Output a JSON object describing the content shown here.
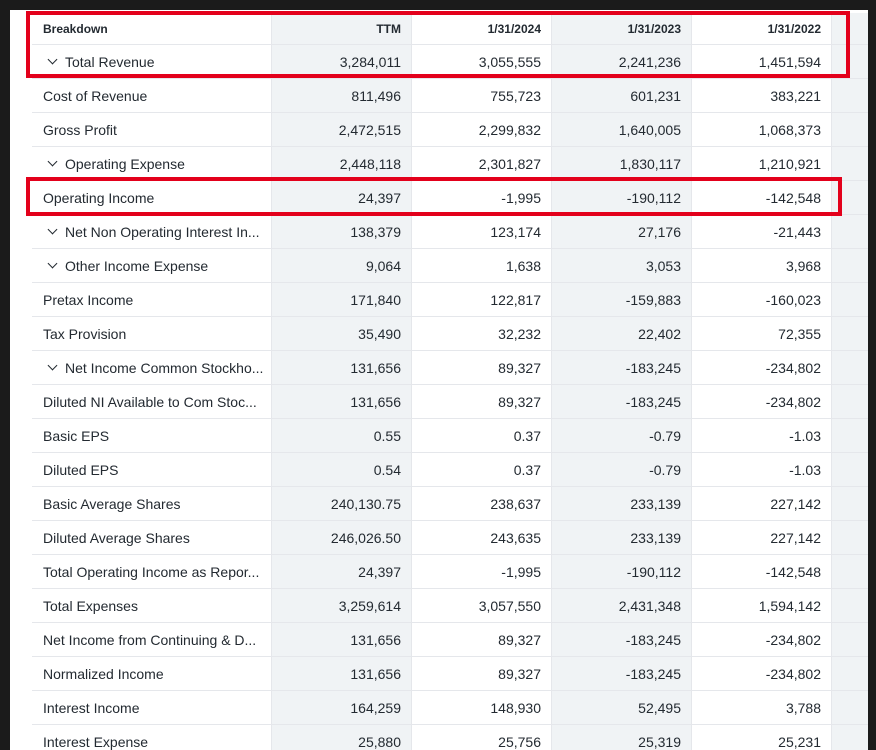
{
  "table": {
    "columns": [
      "Breakdown",
      "TTM",
      "1/31/2024",
      "1/31/2023",
      "1/31/2022"
    ],
    "rows": [
      {
        "label": "Total Revenue",
        "expandable": true,
        "values": [
          "3,284,011",
          "3,055,555",
          "2,241,236",
          "1,451,594"
        ]
      },
      {
        "label": "Cost of Revenue",
        "expandable": false,
        "values": [
          "811,496",
          "755,723",
          "601,231",
          "383,221"
        ]
      },
      {
        "label": "Gross Profit",
        "expandable": false,
        "values": [
          "2,472,515",
          "2,299,832",
          "1,640,005",
          "1,068,373"
        ]
      },
      {
        "label": "Operating Expense",
        "expandable": true,
        "values": [
          "2,448,118",
          "2,301,827",
          "1,830,117",
          "1,210,921"
        ]
      },
      {
        "label": "Operating Income",
        "expandable": false,
        "values": [
          "24,397",
          "-1,995",
          "-190,112",
          "-142,548"
        ]
      },
      {
        "label": "Net Non Operating Interest In...",
        "expandable": true,
        "values": [
          "138,379",
          "123,174",
          "27,176",
          "-21,443"
        ]
      },
      {
        "label": "Other Income Expense",
        "expandable": true,
        "values": [
          "9,064",
          "1,638",
          "3,053",
          "3,968"
        ]
      },
      {
        "label": "Pretax Income",
        "expandable": false,
        "values": [
          "171,840",
          "122,817",
          "-159,883",
          "-160,023"
        ]
      },
      {
        "label": "Tax Provision",
        "expandable": false,
        "values": [
          "35,490",
          "32,232",
          "22,402",
          "72,355"
        ]
      },
      {
        "label": "Net Income Common Stockho...",
        "expandable": true,
        "values": [
          "131,656",
          "89,327",
          "-183,245",
          "-234,802"
        ]
      },
      {
        "label": "Diluted NI Available to Com Stoc...",
        "expandable": false,
        "values": [
          "131,656",
          "89,327",
          "-183,245",
          "-234,802"
        ]
      },
      {
        "label": "Basic EPS",
        "expandable": false,
        "values": [
          "0.55",
          "0.37",
          "-0.79",
          "-1.03"
        ]
      },
      {
        "label": "Diluted EPS",
        "expandable": false,
        "values": [
          "0.54",
          "0.37",
          "-0.79",
          "-1.03"
        ]
      },
      {
        "label": "Basic Average Shares",
        "expandable": false,
        "values": [
          "240,130.75",
          "238,637",
          "233,139",
          "227,142"
        ]
      },
      {
        "label": "Diluted Average Shares",
        "expandable": false,
        "values": [
          "246,026.50",
          "243,635",
          "233,139",
          "227,142"
        ]
      },
      {
        "label": "Total Operating Income as Repor...",
        "expandable": false,
        "values": [
          "24,397",
          "-1,995",
          "-190,112",
          "-142,548"
        ]
      },
      {
        "label": "Total Expenses",
        "expandable": false,
        "values": [
          "3,259,614",
          "3,057,550",
          "2,431,348",
          "1,594,142"
        ]
      },
      {
        "label": "Net Income from Continuing & D...",
        "expandable": false,
        "values": [
          "131,656",
          "89,327",
          "-183,245",
          "-234,802"
        ]
      },
      {
        "label": "Normalized Income",
        "expandable": false,
        "values": [
          "131,656",
          "89,327",
          "-183,245",
          "-234,802"
        ]
      },
      {
        "label": "Interest Income",
        "expandable": false,
        "values": [
          "164,259",
          "148,930",
          "52,495",
          "3,788"
        ]
      },
      {
        "label": "Interest Expense",
        "expandable": false,
        "values": [
          "25,880",
          "25,756",
          "25,319",
          "25,231"
        ]
      }
    ]
  },
  "highlights": {
    "color": "#e3001b",
    "rows": [
      "header+Total Revenue",
      "Operating Income"
    ]
  },
  "colors": {
    "band": "#f0f3f5",
    "text": "#232a31",
    "border": "#e5e7eb"
  }
}
